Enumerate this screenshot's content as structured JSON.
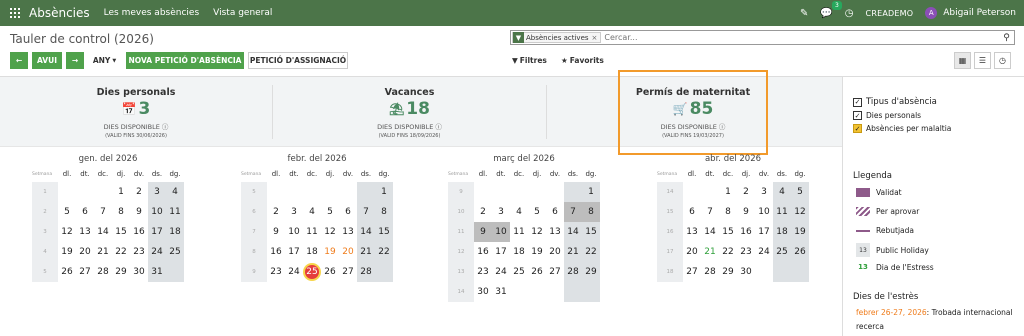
{
  "topbar": {
    "app_title": "Absències",
    "menu": [
      "Les meves absències",
      "Vista general"
    ],
    "badge_count": "3",
    "company": "CREADEMO",
    "avatar_letter": "A",
    "user": "Abigail Peterson"
  },
  "breadcrumb": "Tauler de control (2026)",
  "search": {
    "facet": "Absències actives",
    "placeholder": "Cercar..."
  },
  "controls": {
    "today": "AVUI",
    "any": "ANY",
    "new_request": "NOVA PETICIÓ D'ABSÈNCIA",
    "assign_request": "PETICIÓ D'ASSIGNACIÓ",
    "filters": "Filtres",
    "favorites": "Favorits"
  },
  "cards": [
    {
      "title": "Dies personals",
      "value": "3",
      "sub": "DIES DISPONIBLE",
      "valid": "(VALID FINS 30/06/2026)",
      "icon": "calendar-icon",
      "icon_char": "📅"
    },
    {
      "title": "Vacances",
      "value": "18",
      "sub": "DIES DISPONIBLE",
      "valid": "(VALID FINS 18/09/2026)",
      "icon": "beach-umbrella-icon",
      "icon_char": "⛱"
    },
    {
      "title": "Permís de maternitat",
      "value": "85",
      "sub": "DIES DISPONIBLE",
      "valid": "(VALID FINS 19/03/2027)",
      "icon": "stroller-icon",
      "icon_char": "🛒"
    }
  ],
  "weekdays": [
    "dl.",
    "dt.",
    "dc.",
    "dj.",
    "dv.",
    "ds.",
    "dg."
  ],
  "week_label": "Setmana",
  "months": [
    {
      "name": "gen. del 2026",
      "weeks": [
        {
          "wk": "1",
          "days": [
            "",
            "",
            "",
            "1",
            "2",
            "3",
            "4"
          ]
        },
        {
          "wk": "2",
          "days": [
            "5",
            "6",
            "7",
            "8",
            "9",
            "10",
            "11"
          ]
        },
        {
          "wk": "3",
          "days": [
            "12",
            "13",
            "14",
            "15",
            "16",
            "17",
            "18"
          ]
        },
        {
          "wk": "4",
          "days": [
            "19",
            "20",
            "21",
            "22",
            "23",
            "24",
            "25"
          ]
        },
        {
          "wk": "5",
          "days": [
            "26",
            "27",
            "28",
            "29",
            "30",
            "31",
            ""
          ]
        }
      ]
    },
    {
      "name": "febr. del 2026",
      "weeks": [
        {
          "wk": "5",
          "days": [
            "",
            "",
            "",
            "",
            "",
            "",
            "1"
          ]
        },
        {
          "wk": "6",
          "days": [
            "2",
            "3",
            "4",
            "5",
            "6",
            "7",
            "8"
          ]
        },
        {
          "wk": "7",
          "days": [
            "9",
            "10",
            "11",
            "12",
            "13",
            "14",
            "15"
          ]
        },
        {
          "wk": "8",
          "days": [
            "16",
            "17",
            "18",
            "19",
            "20",
            "21",
            "22"
          ]
        },
        {
          "wk": "9",
          "days": [
            "23",
            "24",
            "25",
            "26",
            "27",
            "28",
            ""
          ]
        }
      ]
    },
    {
      "name": "març del 2026",
      "weeks": [
        {
          "wk": "9",
          "days": [
            "",
            "",
            "",
            "",
            "",
            "",
            "1"
          ]
        },
        {
          "wk": "10",
          "days": [
            "2",
            "3",
            "4",
            "5",
            "6",
            "7",
            "8"
          ]
        },
        {
          "wk": "11",
          "days": [
            "9",
            "10",
            "11",
            "12",
            "13",
            "14",
            "15"
          ]
        },
        {
          "wk": "12",
          "days": [
            "16",
            "17",
            "18",
            "19",
            "20",
            "21",
            "22"
          ]
        },
        {
          "wk": "13",
          "days": [
            "23",
            "24",
            "25",
            "26",
            "27",
            "28",
            "29"
          ]
        },
        {
          "wk": "14",
          "days": [
            "30",
            "31",
            "",
            "",
            "",
            "",
            ""
          ]
        }
      ]
    },
    {
      "name": "abr. del 2026",
      "weeks": [
        {
          "wk": "14",
          "days": [
            "",
            "",
            "1",
            "2",
            "3",
            "4",
            "5"
          ]
        },
        {
          "wk": "15",
          "days": [
            "6",
            "7",
            "8",
            "9",
            "10",
            "11",
            "12"
          ]
        },
        {
          "wk": "16",
          "days": [
            "13",
            "14",
            "15",
            "16",
            "17",
            "18",
            "19"
          ]
        },
        {
          "wk": "17",
          "days": [
            "20",
            "21",
            "22",
            "23",
            "24",
            "25",
            "26"
          ]
        },
        {
          "wk": "18",
          "days": [
            "27",
            "28",
            "29",
            "30",
            "",
            "",
            ""
          ]
        }
      ]
    }
  ],
  "sidebar": {
    "type_header": "Tipus d'absència",
    "types": [
      "Dies personals",
      "Absències per malaltia"
    ],
    "legend_header": "Llegenda",
    "legend": [
      "Validat",
      "Per aprovar",
      "Rebutjada",
      "Public Holiday",
      "Dia de l'Estress"
    ],
    "legend_num_ph": "13",
    "legend_num_st": "13",
    "stress_header": "Dies de l'estrès",
    "stress_date": "febrer 26-27, 2026",
    "stress_text": ": Trobada internacional",
    "stress_text2": "recerca"
  },
  "colors": {
    "topbar": "#4c7549",
    "accent_green": "#4fa24b",
    "number_green": "#4a8a62",
    "highlight_orange": "#f29a2b",
    "today_red": "#e53c3c"
  }
}
